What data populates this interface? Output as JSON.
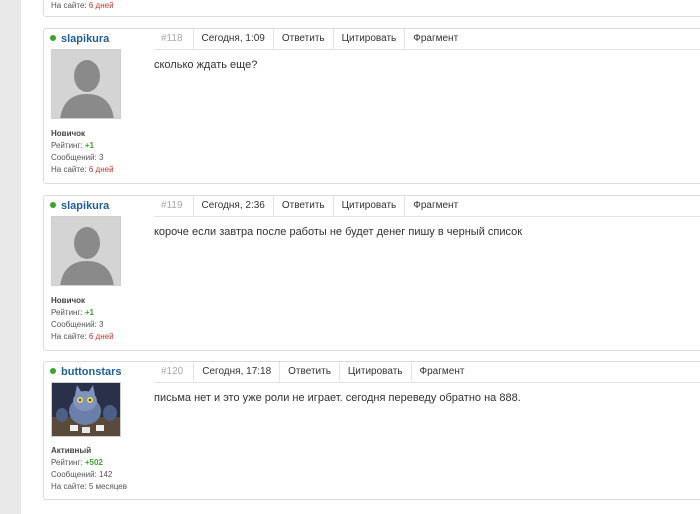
{
  "top_stub": {
    "online_label": "На сайте:",
    "online_value": "6 дней"
  },
  "actions": {
    "reply": "Ответить",
    "quote": "Цитировать",
    "fragment": "Фрагмент"
  },
  "labels": {
    "rating": "Рейтинг:",
    "messages": "Сообщений:",
    "online": "На сайте:"
  },
  "posts": [
    {
      "number": "#118",
      "author": "slapikura",
      "rank": "Новичок",
      "rating": "+1",
      "messages": "3",
      "online_for": "6 дней",
      "time": "Сегодня, 1:09",
      "text": "сколько ждать еще?"
    },
    {
      "number": "#119",
      "author": "slapikura",
      "rank": "Новичок",
      "rating": "+1",
      "messages": "3",
      "online_for": "6 дней",
      "time": "Сегодня, 2:36",
      "text": "короче если завтра после работы не будет денег пишу в черный список"
    },
    {
      "number": "#120",
      "author": "buttonstars",
      "rank": "Активный",
      "rating": "+502",
      "messages": "142",
      "online_for": "5 месяцев",
      "time": "Сегодня, 17:18",
      "text": "письма нет и это уже роли не играет. сегодня переведу обратно на 888."
    }
  ],
  "colors": {
    "username": "#1f5f9b",
    "online_dot": "#3aa52c",
    "positive": "#3aa52c",
    "days_red": "#c0392b"
  }
}
